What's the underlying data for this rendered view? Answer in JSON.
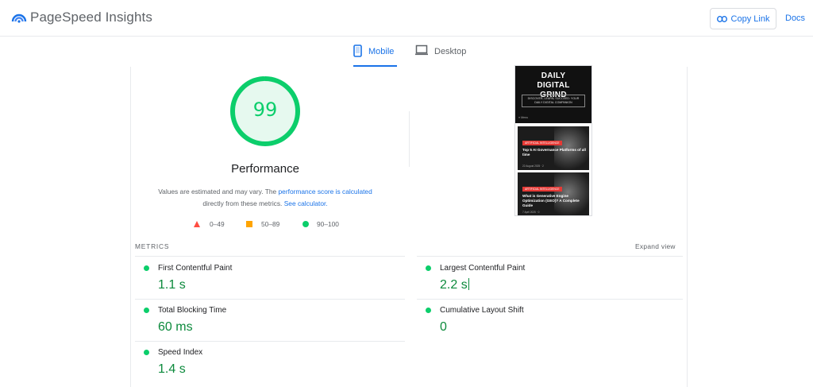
{
  "header": {
    "brand": "PageSpeed Insights",
    "copy_link_label": "Copy Link",
    "docs_label": "Docs",
    "accent_color": "#1a73e8"
  },
  "tabs": [
    {
      "label": "Mobile",
      "active": true,
      "icon": "mobile-icon"
    },
    {
      "label": "Desktop",
      "active": false,
      "icon": "desktop-icon"
    }
  ],
  "performance": {
    "score": "99",
    "score_fraction": 0.99,
    "title": "Performance",
    "desc_prefix": "Values are estimated and may vary. The ",
    "desc_link1": "performance score is calculated",
    "desc_middle": "directly from these metrics. ",
    "desc_link2": "See calculator.",
    "good_color": "#0cce6b"
  },
  "legend": [
    {
      "range": "0–49",
      "shape": "triangle",
      "color": "#ff4e42"
    },
    {
      "range": "50–89",
      "shape": "square",
      "color": "#ffa400"
    },
    {
      "range": "90–100",
      "shape": "circle",
      "color": "#0cce6b"
    }
  ],
  "screenshot": {
    "site_title": "DAILY DIGITAL GRIND",
    "tagline": "DISCOVER, LEARN, SUCCEED: YOUR DAILY DIGITAL COMPANION",
    "menu": "≡ Menu",
    "cards": [
      {
        "tag": "ARTIFICIAL INTELLIGENCE",
        "title": "Top 5 AI Governance Platforms of all time",
        "meta": "22 August 2025 · 2"
      },
      {
        "tag": "ARTIFICIAL INTELLIGENCE",
        "title": "What is Generative Engine Optimization (GEO)? A Complete Guide",
        "meta": "7 April 2025 · 0"
      }
    ]
  },
  "metrics": {
    "header": "METRICS",
    "expand_label": "Expand view",
    "items": [
      {
        "label": "First Contentful Paint",
        "value": "1.1 s"
      },
      {
        "label": "Largest Contentful Paint",
        "value": "2.2 s"
      },
      {
        "label": "Total Blocking Time",
        "value": "60 ms"
      },
      {
        "label": "Cumulative Layout Shift",
        "value": "0"
      },
      {
        "label": "Speed Index",
        "value": "1.4 s"
      }
    ]
  }
}
